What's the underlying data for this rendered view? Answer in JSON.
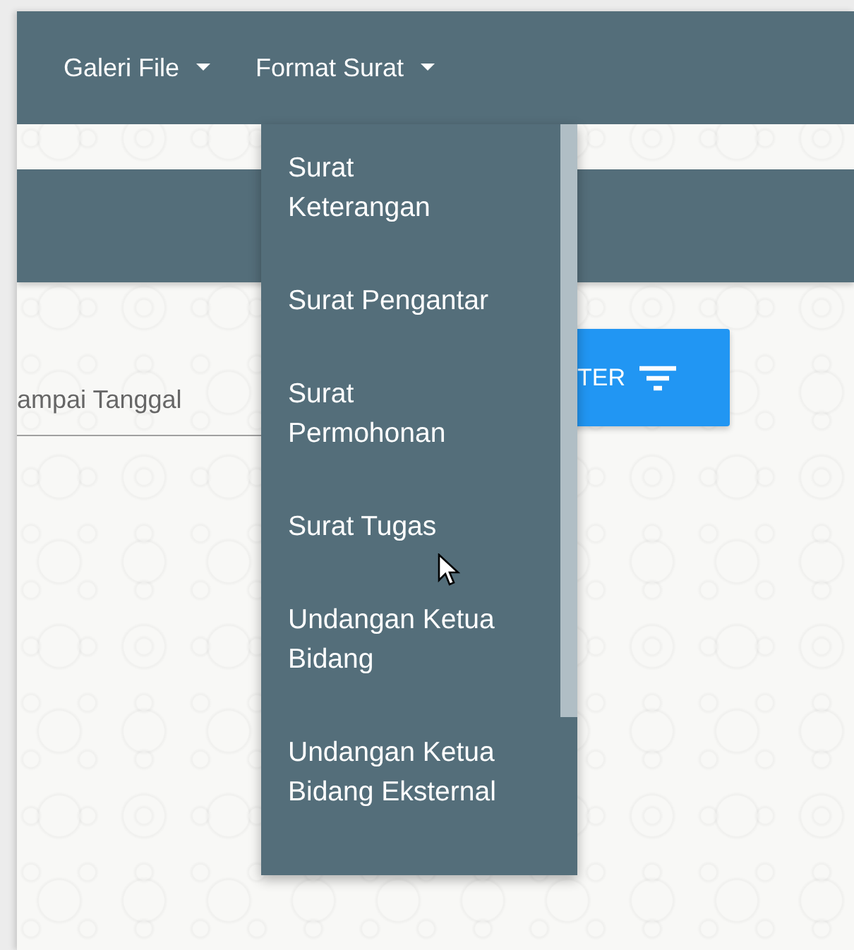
{
  "navbar": {
    "items": [
      {
        "label": "Galeri File"
      },
      {
        "label": "Format Surat",
        "menu": [
          {
            "lines": [
              "Surat",
              "Keterangan"
            ]
          },
          {
            "lines": [
              "Surat Pengantar"
            ]
          },
          {
            "lines": [
              "Surat",
              "Permohonan"
            ]
          },
          {
            "lines": [
              "Surat Tugas"
            ]
          },
          {
            "lines": [
              "Undangan Ketua",
              "Bidang"
            ]
          },
          {
            "lines": [
              "Undangan Ketua",
              "Bidang Eksternal"
            ]
          }
        ]
      }
    ]
  },
  "filter": {
    "date_field": {
      "placeholder": "ampai Tanggal"
    },
    "button": {
      "label": "TER"
    }
  }
}
